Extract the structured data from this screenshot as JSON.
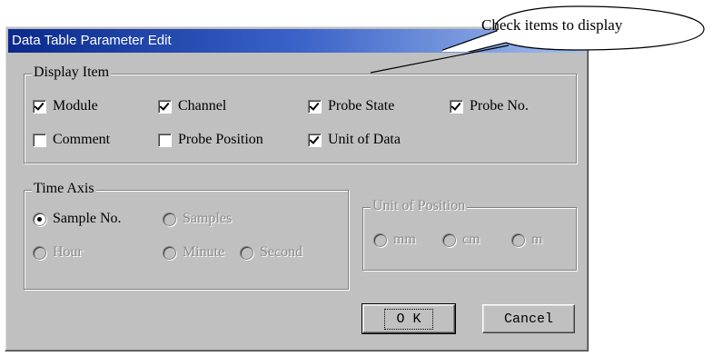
{
  "dialog": {
    "title": "Data Table Parameter Edit",
    "display_item": {
      "legend": "Display Item",
      "items": [
        {
          "label": "Module",
          "checked": true
        },
        {
          "label": "Channel",
          "checked": true
        },
        {
          "label": "Probe State",
          "checked": true
        },
        {
          "label": "Probe No.",
          "checked": true
        },
        {
          "label": "Comment",
          "checked": false
        },
        {
          "label": "Probe Position",
          "checked": false
        },
        {
          "label": "Unit of Data",
          "checked": true
        }
      ]
    },
    "time_axis": {
      "legend": "Time Axis",
      "options": [
        {
          "label": "Sample No.",
          "selected": true,
          "enabled": true
        },
        {
          "label": "Samples",
          "selected": false,
          "enabled": false
        },
        {
          "label": "Hour",
          "selected": false,
          "enabled": false
        },
        {
          "label": "Minute",
          "selected": false,
          "enabled": false
        },
        {
          "label": "Second",
          "selected": false,
          "enabled": false
        }
      ]
    },
    "unit_of_position": {
      "legend": "Unit of Position",
      "options": [
        {
          "label": "mm",
          "enabled": false
        },
        {
          "label": "cm",
          "enabled": false
        },
        {
          "label": "m",
          "enabled": false
        }
      ]
    },
    "buttons": {
      "ok": "O K",
      "cancel": "Cancel"
    }
  },
  "callout": {
    "text": "Check items to display"
  },
  "colors": {
    "titlebar_start": "#0a2a8c",
    "titlebar_end": "#a6c0ee",
    "dialog_bg": "#c0c0c0"
  }
}
